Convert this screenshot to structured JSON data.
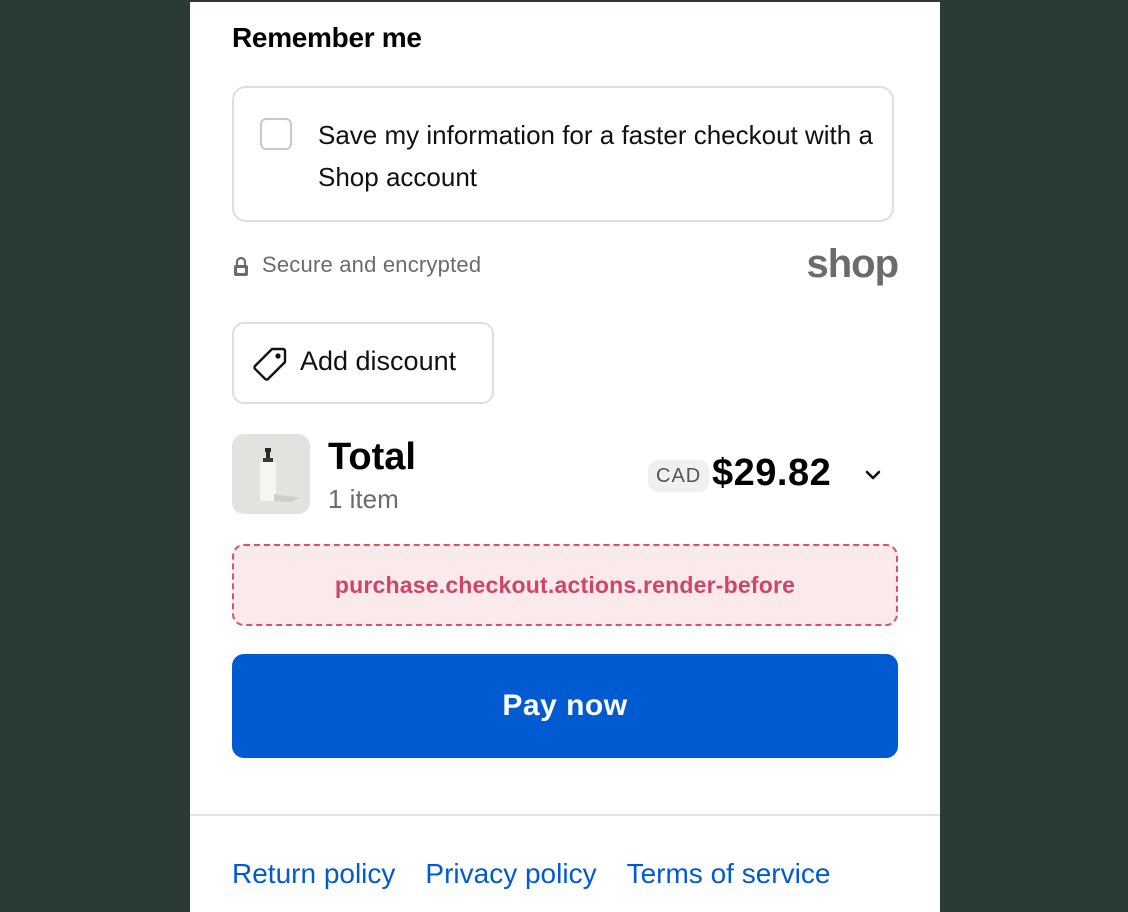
{
  "remember": {
    "title": "Remember me",
    "checkbox_label": "Save my information for a faster checkout with a Shop account",
    "checked": false
  },
  "security": {
    "text": "Secure and encrypted",
    "lock_icon": "lock-icon",
    "brand": "shop"
  },
  "discount": {
    "label": "Add discount",
    "icon": "tag-icon"
  },
  "order": {
    "total_label": "Total",
    "items_label": "1 item",
    "currency": "CAD",
    "amount": "$29.82",
    "chevron_icon": "chevron-down-icon"
  },
  "extension_target": {
    "label": "purchase.checkout.actions.render-before"
  },
  "pay_button": {
    "label": "Pay now",
    "color": "#005bd3"
  },
  "footer": {
    "links": [
      "Return policy",
      "Privacy policy",
      "Terms of service"
    ]
  },
  "colors": {
    "background": "#2a3a34",
    "accent": "#005bd3",
    "extension_border": "#d8526c",
    "extension_text": "#d0436a"
  }
}
